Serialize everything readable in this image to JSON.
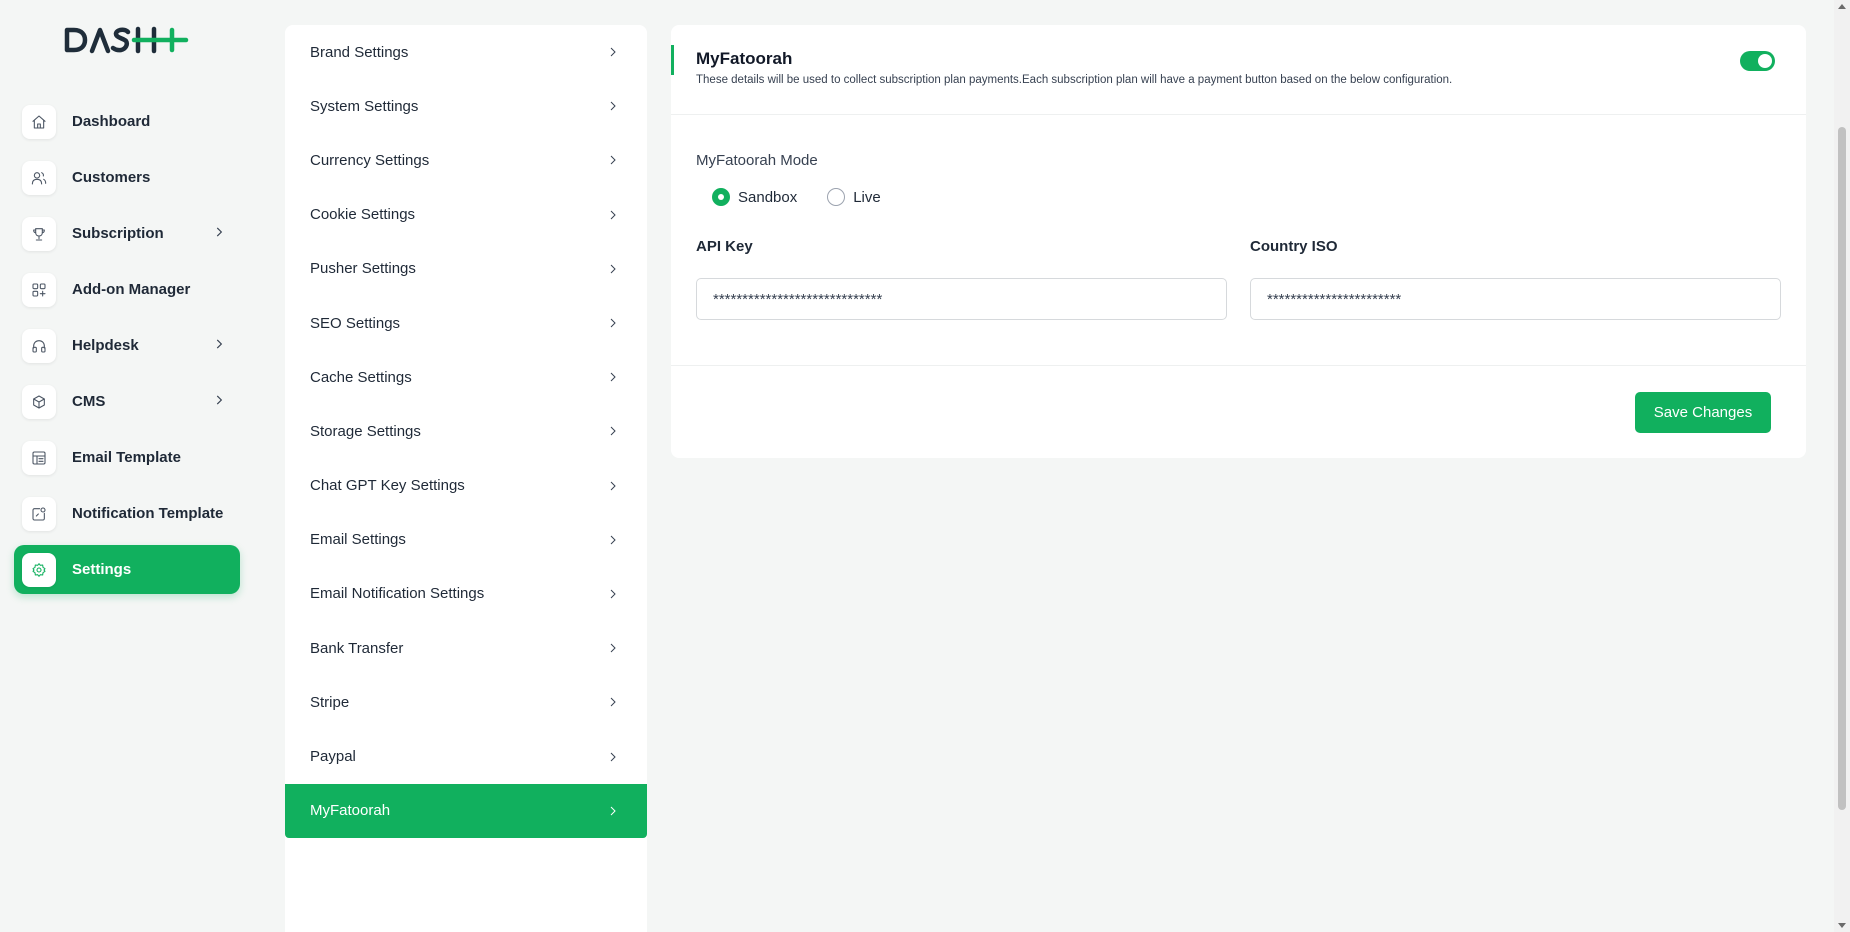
{
  "brand": {
    "logo_text": "DASH",
    "accent": "#11b05e"
  },
  "sidebar": {
    "items": [
      {
        "label": "Dashboard",
        "icon": "home-icon",
        "has_children": false,
        "active": false
      },
      {
        "label": "Customers",
        "icon": "users-icon",
        "has_children": false,
        "active": false
      },
      {
        "label": "Subscription",
        "icon": "trophy-icon",
        "has_children": true,
        "active": false
      },
      {
        "label": "Add-on Manager",
        "icon": "grid-icon",
        "has_children": false,
        "active": false
      },
      {
        "label": "Helpdesk",
        "icon": "headphones-icon",
        "has_children": true,
        "active": false
      },
      {
        "label": "CMS",
        "icon": "cube-icon",
        "has_children": true,
        "active": false
      },
      {
        "label": "Email Template",
        "icon": "template-icon",
        "has_children": false,
        "active": false
      },
      {
        "label": "Notification Template",
        "icon": "notification-icon",
        "has_children": false,
        "active": false
      },
      {
        "label": "Settings",
        "icon": "gear-icon",
        "has_children": false,
        "active": true
      }
    ]
  },
  "settings_menu": {
    "items": [
      {
        "label": "Brand Settings",
        "active": false
      },
      {
        "label": "System Settings",
        "active": false
      },
      {
        "label": "Currency Settings",
        "active": false
      },
      {
        "label": "Cookie Settings",
        "active": false
      },
      {
        "label": "Pusher Settings",
        "active": false
      },
      {
        "label": "SEO Settings",
        "active": false
      },
      {
        "label": "Cache Settings",
        "active": false
      },
      {
        "label": "Storage Settings",
        "active": false
      },
      {
        "label": "Chat GPT Key Settings",
        "active": false
      },
      {
        "label": "Email Settings",
        "active": false
      },
      {
        "label": "Email Notification Settings",
        "active": false
      },
      {
        "label": "Bank Transfer",
        "active": false
      },
      {
        "label": "Stripe",
        "active": false
      },
      {
        "label": "Paypal",
        "active": false
      },
      {
        "label": "MyFatoorah",
        "active": true
      }
    ]
  },
  "card": {
    "title": "MyFatoorah",
    "description": "These details will be used to collect subscription plan payments.Each subscription plan will have a payment button based on the below configuration.",
    "enabled": true,
    "mode_label": "MyFatoorah Mode",
    "modes": [
      {
        "label": "Sandbox",
        "checked": true
      },
      {
        "label": "Live",
        "checked": false
      }
    ],
    "api_key": {
      "label": "API Key",
      "value": "*****************************"
    },
    "country_iso": {
      "label": "Country ISO",
      "value": "***********************"
    },
    "save_label": "Save Changes"
  }
}
